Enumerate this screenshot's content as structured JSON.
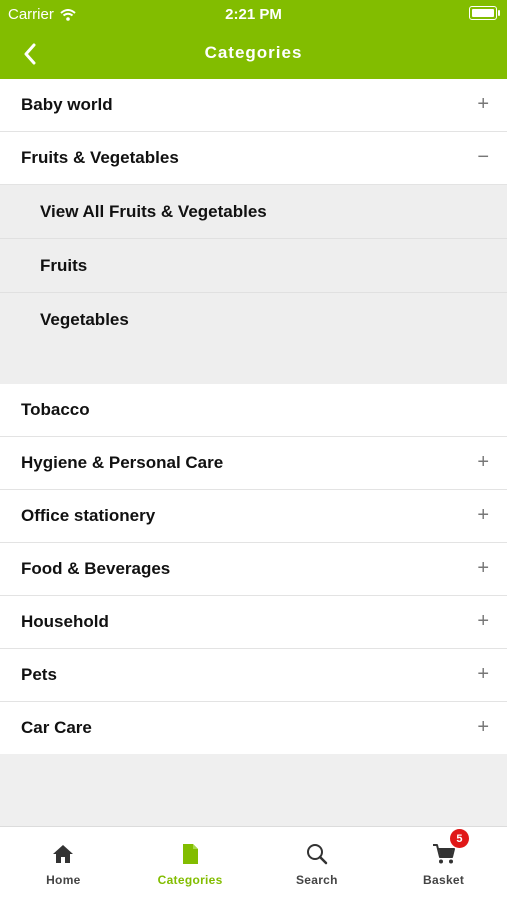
{
  "status_bar": {
    "carrier": "Carrier",
    "time": "2:21 PM"
  },
  "header": {
    "title": "Categories"
  },
  "categories": [
    {
      "label": "Baby world",
      "sign": "+"
    },
    {
      "label": "Fruits & Vegetables",
      "sign": "−"
    }
  ],
  "subcategories": [
    {
      "label": "View All Fruits & Vegetables"
    },
    {
      "label": "Fruits"
    },
    {
      "label": "Vegetables"
    }
  ],
  "categories_rest": [
    {
      "label": "Tobacco",
      "sign": ""
    },
    {
      "label": "Hygiene & Personal Care",
      "sign": "+"
    },
    {
      "label": "Office stationery",
      "sign": "+"
    },
    {
      "label": "Food & Beverages",
      "sign": "+"
    },
    {
      "label": "Household",
      "sign": "+"
    },
    {
      "label": "Pets",
      "sign": "+"
    },
    {
      "label": "Car Care",
      "sign": "+"
    }
  ],
  "tabs": [
    {
      "label": "Home",
      "icon": "home-icon"
    },
    {
      "label": "Categories",
      "icon": "categories-icon",
      "active": true
    },
    {
      "label": "Search",
      "icon": "search-icon"
    },
    {
      "label": "Basket",
      "icon": "cart-icon",
      "badge": "5"
    }
  ],
  "colors": {
    "brand_green": "#82bd00",
    "badge_red": "#e01818"
  }
}
